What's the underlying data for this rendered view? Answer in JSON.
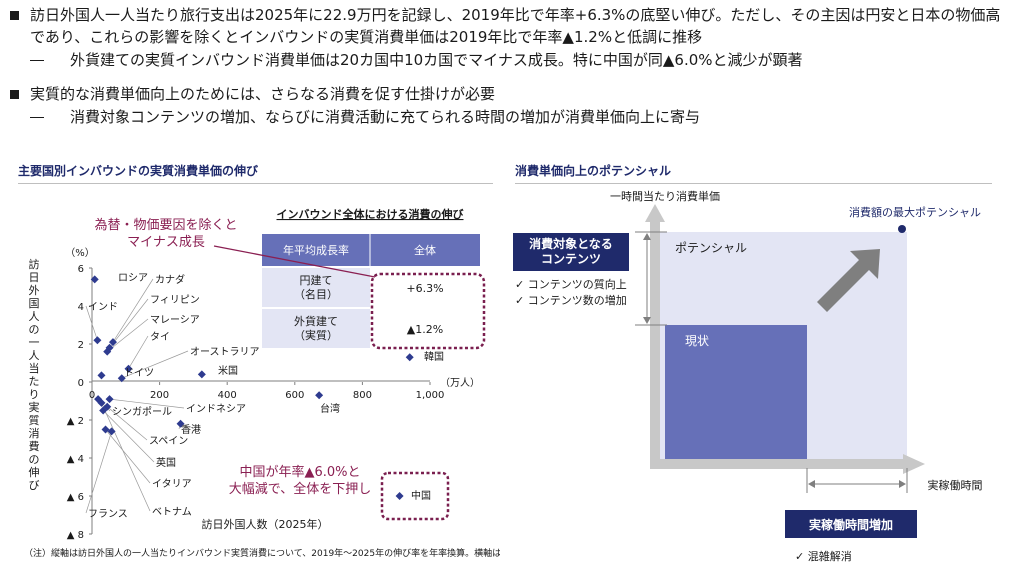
{
  "bullets": [
    {
      "text": "訪日外国人一人当たり旅行支出は2025年に22.9万円を記録し、2019年比で年率+6.3%の底堅い伸び。ただし、その主因は円安と日本の物価高であり、これらの影響を除くとインバウンドの実質消費単価は2019年比で年率▲1.2%と低調に推移",
      "sub": "外貨建ての実質インバウンド消費単価は20カ国中10カ国でマイナス成長。特に中国が同▲6.0%と減少が顕著"
    },
    {
      "text": "実質的な消費単価向上のためには、さらなる消費を促す仕掛けが必要",
      "sub": "消費対象コンテンツの増加、ならびに消費活動に充てられる時間の増加が消費単価向上に寄与"
    }
  ],
  "left_title": "主要国別インバウンドの実質消費単価の伸び",
  "right_title": "消費単価向上のポテンシャル",
  "chart_data": [
    {
      "type": "scatter",
      "title": "",
      "xlabel": "訪日外国人数（2025年）",
      "ylabel": "訪日外国人の一人当たり実質消費の伸び",
      "xunit": "（万人）",
      "yunit": "（%）",
      "xlim": [
        0,
        1000
      ],
      "ylim": [
        -8,
        6
      ],
      "xticks": [
        "0",
        "200",
        "400",
        "600",
        "800",
        "1,000"
      ],
      "yticks": [
        "6",
        "4",
        "2",
        "0",
        "▲ 2",
        "▲ 4",
        "▲ 6",
        "▲ 8"
      ],
      "marker_color": "#2e3b8f",
      "points": [
        {
          "label": "ロシア",
          "x": 8,
          "y": 5.4
        },
        {
          "label": "カナダ",
          "x": 62,
          "y": 2.1
        },
        {
          "label": "フィリピン",
          "x": 52,
          "y": 1.8
        },
        {
          "label": "インド",
          "x": 16,
          "y": 2.2
        },
        {
          "label": "マレーシア",
          "x": 45,
          "y": 1.6
        },
        {
          "label": "タイ",
          "x": 108,
          "y": 0.7
        },
        {
          "label": "オーストラリア",
          "x": 88,
          "y": 0.2
        },
        {
          "label": "ドイツ",
          "x": 28,
          "y": 0.35
        },
        {
          "label": "米国",
          "x": 325,
          "y": 0.4
        },
        {
          "label": "韓国",
          "x": 940,
          "y": 1.3
        },
        {
          "label": "台湾",
          "x": 672,
          "y": -0.7
        },
        {
          "label": "インドネシア",
          "x": 52,
          "y": -0.9
        },
        {
          "label": "シンガポール",
          "x": 18,
          "y": -0.9
        },
        {
          "label": "香港",
          "x": 262,
          "y": -2.2
        },
        {
          "label": "スペイン",
          "x": 45,
          "y": -1.3
        },
        {
          "label": "英国",
          "x": 33,
          "y": -1.5
        },
        {
          "label": "イタリア",
          "x": 40,
          "y": -2.5
        },
        {
          "label": "フランス",
          "x": 58,
          "y": -2.6
        },
        {
          "label": "ベトナム",
          "x": 28,
          "y": -1.1
        },
        {
          "label": "中国",
          "x": 910,
          "y": -6.0
        }
      ],
      "table": {
        "title": "インバウンド全体における消費の伸び",
        "headers": [
          "年平均成長率",
          "全体"
        ],
        "rows": [
          {
            "label": "円建て\n（名目）",
            "value": "+6.3%"
          },
          {
            "label": "外貨建て\n（実質）",
            "value": "▲1.2%"
          }
        ]
      },
      "annotations": [
        "為替・物価要因を除くと\nマイナス成長",
        "中国が年率▲6.0%と\n大幅減で、全体を下押し"
      ],
      "note": "（注）縦軸は訪日外国人の一人当たりインバウンド実質消費について、2019年〜2025年の伸び率を年率換算。横軸は2025年の訪日外客数"
    },
    {
      "type": "diagram",
      "ylabel": "一時間当たり消費単価",
      "xlabel": "実稼働時間",
      "max_label": "消費額の最大ポテンシャル",
      "potential_label": "ポテンシャル",
      "current_label": "現状",
      "content_box": "消費対象となる\nコンテンツ",
      "content_checks": [
        "コンテンツの質向上",
        "コンテンツ数の増加"
      ],
      "time_box": "実稼働時間増加",
      "time_checks": [
        "混雑解消"
      ],
      "colors": {
        "potential": "#e3e5f4",
        "current": "#6670b8",
        "navy": "#1f2a6b",
        "axis": "#c8c8c8",
        "arrow": "#7f7f7f"
      }
    }
  ]
}
